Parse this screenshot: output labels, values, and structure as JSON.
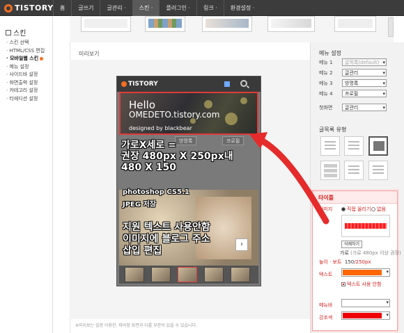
{
  "topbar": {
    "logo": "TISTORY",
    "nav": [
      "홈",
      "글쓰기",
      "글관리 ·",
      "스킨 ·",
      "플러그인 ·",
      "링크 ·",
      "환경설정 ·"
    ]
  },
  "sidebar": {
    "title": "스킨",
    "items": [
      "· 스킨 선택",
      "· HTML/CSS 편집",
      "· 모바일웹 스킨",
      "· 메뉴 설정",
      "· 사이드바 설정",
      "· 화면출력 설정",
      "· 카테고리 설정",
      "· 티에디션 설정"
    ]
  },
  "main": {
    "preview_label": "미리보기",
    "footer_note": "※미리보는 설명 이용한, 파비점 화면과 다를 부분이 있을 수 있습니다."
  },
  "phone": {
    "logo": "TISTORY",
    "banner": {
      "hello": "Hello",
      "url": "OMEDETO.tistory.com",
      "designed": "designed by blackbear"
    },
    "tabs": [
      "방명록",
      "프로필"
    ],
    "overlay_lines": {
      "line1": "가로X세로 =",
      "line2": "권장 480px X 250px내",
      "line3": "480 X 150",
      "line4": "photoshop CS5.1",
      "line5": "JPEG 저장",
      "line6": "지원 텍스트 사용안함",
      "line7": "이미지에 블로그 주소",
      "line8": "삽입 편집"
    },
    "next_label": "›"
  },
  "right_panel": {
    "menu_title": "메뉴 설정",
    "menus": [
      {
        "label": "메뉴 1",
        "value": "글목록(default)",
        "disabled": true
      },
      {
        "label": "메뉴 2",
        "value": "글관리"
      },
      {
        "label": "메뉴 3",
        "value": "방명록"
      },
      {
        "label": "메뉴 4",
        "value": "프로필"
      },
      {
        "label": "첫화면",
        "value": "글관리"
      }
    ],
    "list_type_title": "글목록 유형"
  },
  "title_popup": {
    "title": "타이틀",
    "image_label": "이미지",
    "radio_direct": "직접 올리기",
    "radio_none": "없음",
    "delete_button": "삭제하기",
    "width_label": "가로",
    "width_value": "(가로 480px 이상 권장)",
    "height_label": "높이 · 보트",
    "height_value": "150",
    "height_unit": "/250px",
    "text_label": "텍스트",
    "text_checkbox": "텍스트 사용 안함",
    "menubar_label": "메뉴바",
    "accent_label": "강조색"
  },
  "colors": {
    "accent": "#f36f21",
    "highlight_red": "#e23a3a",
    "text_color_field": "#ff6600",
    "accent_color_field": "#ee0000"
  }
}
